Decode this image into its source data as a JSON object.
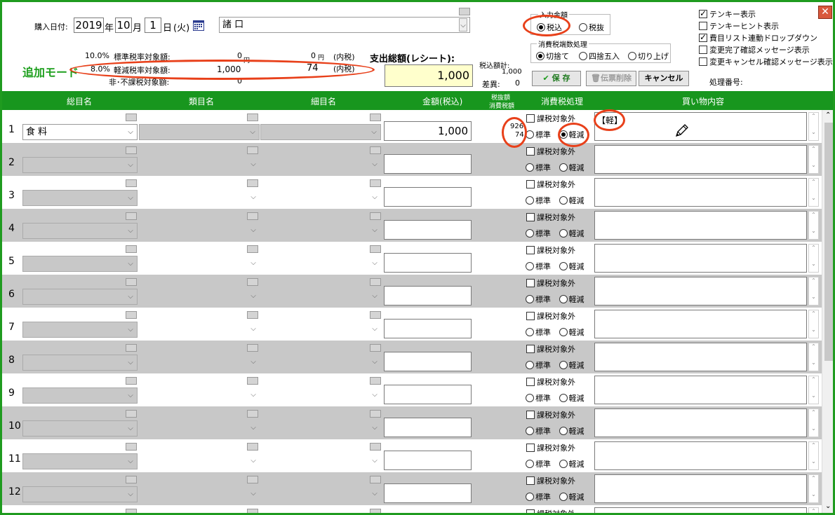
{
  "header": {
    "purchase_date_label": "購入日付:",
    "year": "2019",
    "year_unit": "年",
    "month": "10",
    "month_unit": "月",
    "day": "1",
    "day_unit": "日",
    "weekday": "(火)",
    "payee": "諸 口"
  },
  "tax_summary": {
    "mode_label": "追加モード",
    "standard_rate": "10.0%",
    "standard_label": "標準税率対象額:",
    "standard_amount": "0",
    "standard_amount_unit": "円",
    "standard_tax": "0",
    "standard_tax_unit": "円",
    "standard_tax_note": "(内税)",
    "reduced_rate": "8.0%",
    "reduced_label": "軽減税率対象額:",
    "reduced_amount": "1,000",
    "reduced_tax": "74",
    "reduced_tax_note": "(内税)",
    "exempt_label": "非･不課税対象額:",
    "exempt_amount": "0"
  },
  "total": {
    "label": "支出総額(レシート):",
    "value": "1,000",
    "tax_total_label": "税込額計:",
    "tax_total_value": "1,000",
    "diff_label": "差異:",
    "diff_value": "0"
  },
  "input_amount": {
    "legend": "入力金額",
    "options": [
      "税込",
      "税抜"
    ],
    "selected": 0
  },
  "rounding": {
    "legend": "消費税端数処理",
    "options": [
      "切捨て",
      "四捨五入",
      "切り上げ"
    ],
    "selected": 0
  },
  "buttons": {
    "save": "保 存",
    "delete": "伝票削除",
    "cancel": "キャンセル"
  },
  "process_number_label": "処理番号:",
  "options": [
    {
      "label": "テンキー表示",
      "checked": true
    },
    {
      "label": "テンキーヒント表示",
      "checked": false
    },
    {
      "label": "費目リスト連動ドロップダウン",
      "checked": true
    },
    {
      "label": "変更完了確認メッセージ表示",
      "checked": false
    },
    {
      "label": "変更キャンセル確認メッセージ表示",
      "checked": false
    }
  ],
  "columns": {
    "total_item": "総目名",
    "category": "類目名",
    "detail": "細目名",
    "amount": "金額(税込)",
    "tax_excl": "税抜額",
    "tax_amount": "消費税額",
    "tax_processing": "消費税処理",
    "memo": "買い物内容"
  },
  "row_labels": {
    "tax_exempt": "課税対象外",
    "standard": "標準",
    "reduced": "軽減"
  },
  "rows": [
    {
      "num": "1",
      "item": "食 料",
      "amount": "1,000",
      "tax_excl": "926",
      "tax": "74",
      "memo": "【軽】",
      "reduced": true
    },
    {
      "num": "2",
      "item": "",
      "amount": "",
      "tax_excl": "",
      "tax": "",
      "memo": "",
      "reduced": false
    },
    {
      "num": "3",
      "item": "",
      "amount": "",
      "tax_excl": "",
      "tax": "",
      "memo": "",
      "reduced": false
    },
    {
      "num": "4",
      "item": "",
      "amount": "",
      "tax_excl": "",
      "tax": "",
      "memo": "",
      "reduced": false
    },
    {
      "num": "5",
      "item": "",
      "amount": "",
      "tax_excl": "",
      "tax": "",
      "memo": "",
      "reduced": false
    },
    {
      "num": "6",
      "item": "",
      "amount": "",
      "tax_excl": "",
      "tax": "",
      "memo": "",
      "reduced": false
    },
    {
      "num": "7",
      "item": "",
      "amount": "",
      "tax_excl": "",
      "tax": "",
      "memo": "",
      "reduced": false
    },
    {
      "num": "8",
      "item": "",
      "amount": "",
      "tax_excl": "",
      "tax": "",
      "memo": "",
      "reduced": false
    },
    {
      "num": "9",
      "item": "",
      "amount": "",
      "tax_excl": "",
      "tax": "",
      "memo": "",
      "reduced": false
    },
    {
      "num": "10",
      "item": "",
      "amount": "",
      "tax_excl": "",
      "tax": "",
      "memo": "",
      "reduced": false
    },
    {
      "num": "11",
      "item": "",
      "amount": "",
      "tax_excl": "",
      "tax": "",
      "memo": "",
      "reduced": false
    },
    {
      "num": "12",
      "item": "",
      "amount": "",
      "tax_excl": "",
      "tax": "",
      "memo": "",
      "reduced": false
    },
    {
      "num": "",
      "item": "",
      "amount": "",
      "tax_excl": "",
      "tax": "",
      "memo": "",
      "reduced": false
    }
  ],
  "colors": {
    "frame_green": "#1f9b1f",
    "header_green": "#18961e",
    "mode_green": "#1fa01f",
    "annotation_red": "#e8401a",
    "total_field_yellow": "#ffffcc",
    "row_gray": "#c8c8c8"
  },
  "icons": [
    "calendar-icon",
    "check-icon",
    "trash-icon",
    "pencil-icon",
    "close-icon",
    "chevron-down-icon"
  ]
}
